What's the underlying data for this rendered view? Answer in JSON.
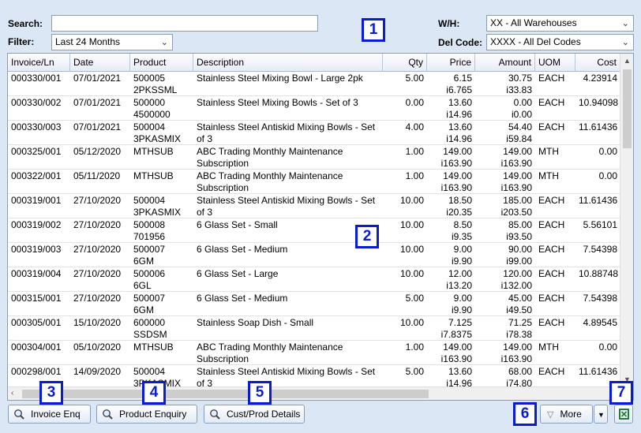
{
  "filters": {
    "search_label": "Search:",
    "search_value": "",
    "filter_label": "Filter:",
    "filter_value": "Last 24 Months",
    "wh_label": "W/H:",
    "wh_value": "XX - All Warehouses",
    "del_label": "Del Code:",
    "del_value": "XXXX - All Del Codes"
  },
  "markers": [
    "1",
    "2",
    "3",
    "4",
    "5",
    "6",
    "7"
  ],
  "columns": [
    "Invoice/Ln",
    "Date",
    "Product",
    "Description",
    "Qty",
    "Price",
    "Amount",
    "UOM",
    "Cost"
  ],
  "rows": [
    {
      "inv": "000330/001",
      "date": "07/01/2021",
      "prod1": "500005",
      "prod2": "2PKSSML",
      "desc": "Stainless Steel Mixing Bowl - Large 2pk",
      "qty": "5.00",
      "price1": "6.15",
      "price2": "i6.765",
      "amt1": "30.75",
      "amt2": "i33.83",
      "uom": "EACH",
      "cost": "4.23914"
    },
    {
      "inv": "000330/002",
      "date": "07/01/2021",
      "prod1": "500000",
      "prod2": "4500000",
      "desc": "Stainless Steel Mixing Bowls - Set of 3",
      "qty": "0.00",
      "price1": "13.60",
      "price2": "i14.96",
      "amt1": "0.00",
      "amt2": "i0.00",
      "uom": "EACH",
      "cost": "10.94098"
    },
    {
      "inv": "000330/003",
      "date": "07/01/2021",
      "prod1": "500004",
      "prod2": "3PKASMIX",
      "desc": "Stainless Steel Antiskid Mixing Bowls - Set of 3",
      "qty": "4.00",
      "price1": "13.60",
      "price2": "i14.96",
      "amt1": "54.40",
      "amt2": "i59.84",
      "uom": "EACH",
      "cost": "11.61436"
    },
    {
      "inv": "000325/001",
      "date": "05/12/2020",
      "prod1": "MTHSUB",
      "prod2": "",
      "desc": "ABC Trading Monthly Maintenance Subscription",
      "qty": "1.00",
      "price1": "149.00",
      "price2": "i163.90",
      "amt1": "149.00",
      "amt2": "i163.90",
      "uom": "MTH",
      "cost": "0.00"
    },
    {
      "inv": "000322/001",
      "date": "05/11/2020",
      "prod1": "MTHSUB",
      "prod2": "",
      "desc": "ABC Trading Monthly Maintenance Subscription",
      "qty": "1.00",
      "price1": "149.00",
      "price2": "i163.90",
      "amt1": "149.00",
      "amt2": "i163.90",
      "uom": "MTH",
      "cost": "0.00"
    },
    {
      "inv": "000319/001",
      "date": "27/10/2020",
      "prod1": "500004",
      "prod2": "3PKASMIX",
      "desc": "Stainless Steel Antiskid Mixing Bowls - Set of 3",
      "qty": "10.00",
      "price1": "18.50",
      "price2": "i20.35",
      "amt1": "185.00",
      "amt2": "i203.50",
      "uom": "EACH",
      "cost": "11.61436"
    },
    {
      "inv": "000319/002",
      "date": "27/10/2020",
      "prod1": "500008",
      "prod2": "701956",
      "desc": "6 Glass Set - Small",
      "qty": "10.00",
      "price1": "8.50",
      "price2": "i9.35",
      "amt1": "85.00",
      "amt2": "i93.50",
      "uom": "EACH",
      "cost": "5.56101"
    },
    {
      "inv": "000319/003",
      "date": "27/10/2020",
      "prod1": "500007",
      "prod2": "6GM",
      "desc": "6 Glass Set - Medium",
      "qty": "10.00",
      "price1": "9.00",
      "price2": "i9.90",
      "amt1": "90.00",
      "amt2": "i99.00",
      "uom": "EACH",
      "cost": "7.54398"
    },
    {
      "inv": "000319/004",
      "date": "27/10/2020",
      "prod1": "500006",
      "prod2": "6GL",
      "desc": "6 Glass Set - Large",
      "qty": "10.00",
      "price1": "12.00",
      "price2": "i13.20",
      "amt1": "120.00",
      "amt2": "i132.00",
      "uom": "EACH",
      "cost": "10.88748"
    },
    {
      "inv": "000315/001",
      "date": "27/10/2020",
      "prod1": "500007",
      "prod2": "6GM",
      "desc": "6 Glass Set - Medium",
      "qty": "5.00",
      "price1": "9.00",
      "price2": "i9.90",
      "amt1": "45.00",
      "amt2": "i49.50",
      "uom": "EACH",
      "cost": "7.54398"
    },
    {
      "inv": "000305/001",
      "date": "15/10/2020",
      "prod1": "600000",
      "prod2": "SSDSM",
      "desc": "Stainless Soap Dish - Small",
      "qty": "10.00",
      "price1": "7.125",
      "price2": "i7.8375",
      "amt1": "71.25",
      "amt2": "i78.38",
      "uom": "EACH",
      "cost": "4.89545"
    },
    {
      "inv": "000304/001",
      "date": "05/10/2020",
      "prod1": "MTHSUB",
      "prod2": "",
      "desc": "ABC Trading Monthly Maintenance Subscription",
      "qty": "1.00",
      "price1": "149.00",
      "price2": "i163.90",
      "amt1": "149.00",
      "amt2": "i163.90",
      "uom": "MTH",
      "cost": "0.00"
    },
    {
      "inv": "000298/001",
      "date": "14/09/2020",
      "prod1": "500004",
      "prod2": "3PKASMIX",
      "desc": "Stainless Steel Antiskid Mixing Bowls - Set of 3",
      "qty": "5.00",
      "price1": "13.60",
      "price2": "i14.96",
      "amt1": "68.00",
      "amt2": "i74.80",
      "uom": "EACH",
      "cost": "11.61436"
    }
  ],
  "buttons": {
    "invoice_enq": "Invoice Enq",
    "product_enquiry": "Product Enquiry",
    "cust_prod": "Cust/Prod Details",
    "more": "More"
  },
  "colors": {
    "marker": "#0a1ccf",
    "background": "#dce7f5",
    "excel": "#1e7b3c"
  },
  "icons": [
    "magnifier-icon",
    "chevron-down-icon",
    "triangle-down-icon",
    "excel-icon"
  ]
}
